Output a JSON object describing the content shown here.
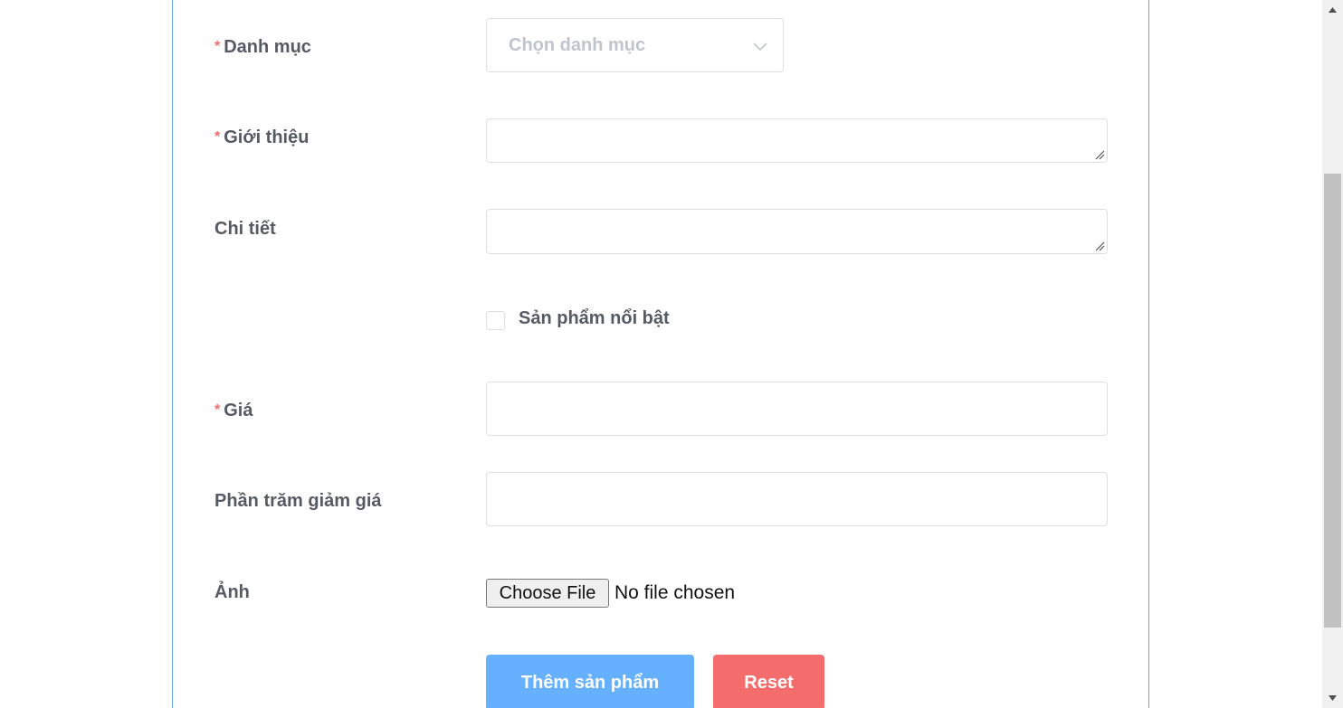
{
  "form": {
    "category": {
      "required_mark": "*",
      "label": "Danh mục",
      "placeholder": "Chọn danh mục"
    },
    "intro": {
      "required_mark": "*",
      "label": "Giới thiệu",
      "value": ""
    },
    "detail": {
      "label": "Chi tiết",
      "value": ""
    },
    "featured": {
      "label": "Sản phẩm nổi bật",
      "checked": false
    },
    "price": {
      "required_mark": "*",
      "label": "Giá",
      "value": ""
    },
    "discount": {
      "label": "Phần trăm giảm giá",
      "value": ""
    },
    "image": {
      "label": "Ảnh",
      "button_label": "Choose File",
      "status": "No file chosen"
    },
    "actions": {
      "submit_label": "Thêm sản phẩm",
      "reset_label": "Reset"
    }
  },
  "colors": {
    "required": "#f56c6c",
    "primary": "#66b1ff",
    "danger": "#f56c6c",
    "border": "#dcdfe6",
    "label": "#555a63",
    "placeholder": "#c0c4cc"
  },
  "icons": {
    "select_caret": "chevron-down-icon",
    "textarea_grip": "resize-grip-icon",
    "scroll_up": "arrow-up-icon",
    "scroll_down": "arrow-down-icon"
  }
}
